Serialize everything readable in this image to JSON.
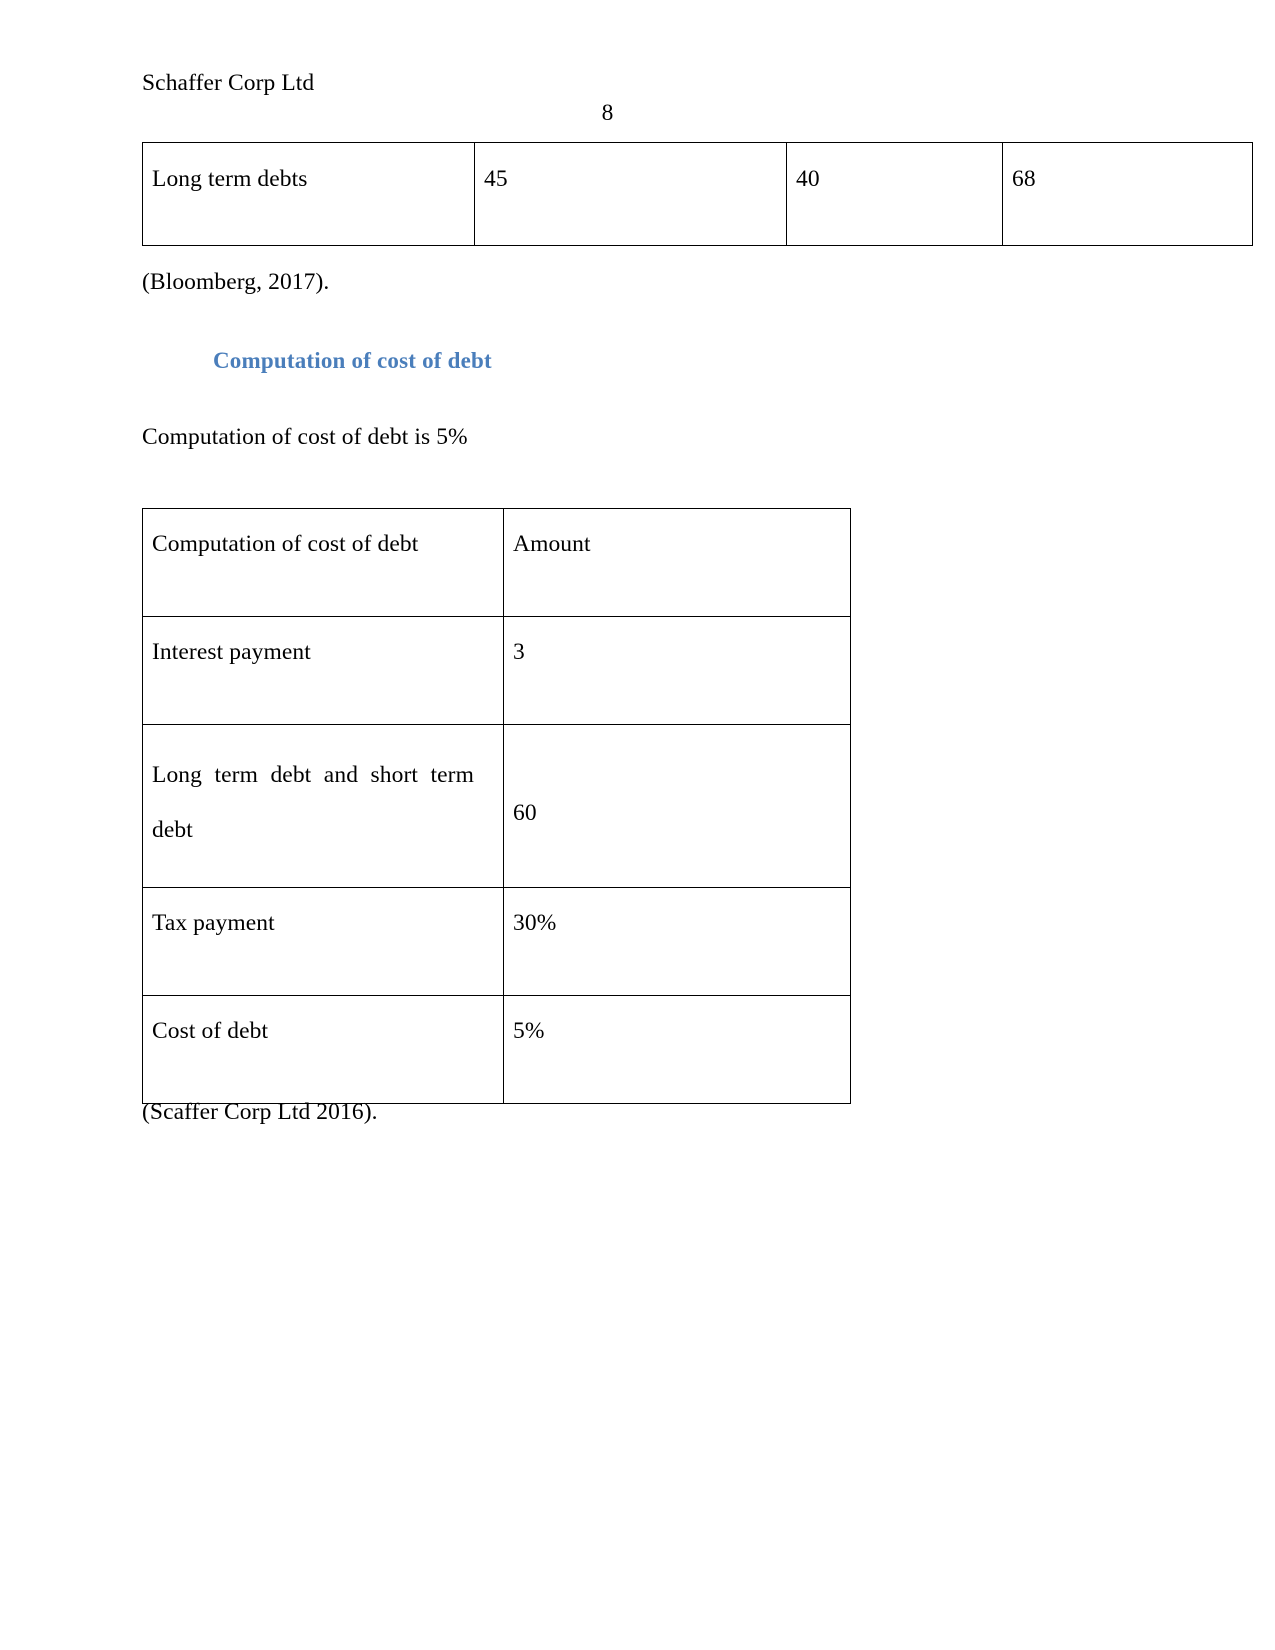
{
  "document": {
    "header": "Schaffer Corp Ltd",
    "page_number": "8"
  },
  "top_table": {
    "rows": [
      {
        "label": "Long term debts",
        "v1": "45",
        "v2": "40",
        "v3": "68"
      }
    ]
  },
  "citations": {
    "bloomberg": "(Bloomberg, 2017).",
    "scaffer": "(Scaffer Corp Ltd 2016)."
  },
  "heading": {
    "text": "Computation of cost of debt",
    "color": "#4A7EBB"
  },
  "intro_paragraph": "Computation of cost of debt is 5%",
  "main_table": {
    "header": {
      "label": "Computation of cost of debt",
      "value": "Amount"
    },
    "rows": [
      {
        "label": "Interest payment",
        "value": "3"
      },
      {
        "label": "Long term debt and short term debt",
        "value": "60"
      },
      {
        "label": "Tax payment",
        "value": "30%"
      },
      {
        "label": "Cost of debt",
        "value": "5%"
      }
    ]
  }
}
